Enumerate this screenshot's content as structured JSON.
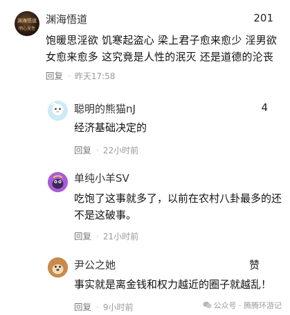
{
  "comments": {
    "main": {
      "username": "渊海悟道",
      "avatar_text_1": "渊海悟道",
      "avatar_text_2": "明心見性",
      "likes": "201",
      "text": "饱暖思淫欲 饥寒起盗心 梁上君子愈来愈少 淫男欲女愈来愈多 这究竟是人性的泯灭 还是道德的沦丧",
      "reply_label": "回复",
      "time": "昨天17:58"
    },
    "replies": [
      {
        "username": "聪明的熊猫nJ",
        "likes": "4",
        "text": "经济基础决定的",
        "reply_label": "回复",
        "time": "22小时前"
      },
      {
        "username": "单纯小羊SV",
        "likes": "",
        "text": "吃饱了这事就多了，以前在农村八卦最多的还不是这破事。",
        "reply_label": "回复",
        "time": "21小时前"
      },
      {
        "username": "尹公之她",
        "likes": "赞",
        "text": "事实就是离金钱和权力越近的圈子就越乱！",
        "reply_label": "回复",
        "time": "9小时前"
      }
    ]
  },
  "watermark": "公众号 · 腾腾环游记",
  "colors": {
    "text": "#111111",
    "meta": "#999999",
    "background": "#ffffff"
  }
}
